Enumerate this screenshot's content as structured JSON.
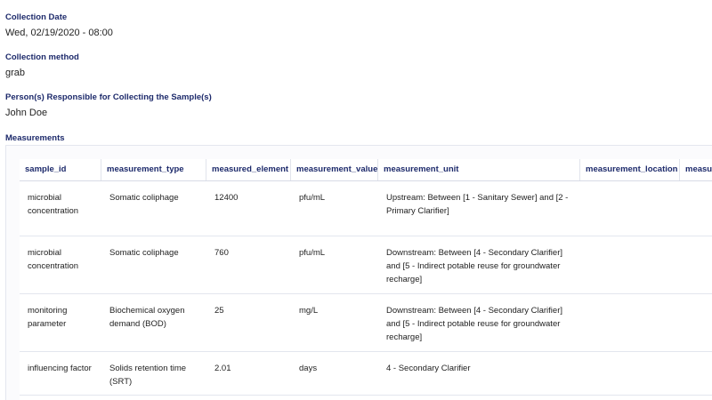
{
  "fields": {
    "collection_date": {
      "label": "Collection Date",
      "value": "Wed, 02/19/2020 - 08:00"
    },
    "collection_method": {
      "label": "Collection method",
      "value": "grab"
    },
    "responsible": {
      "label": "Person(s) Responsible for Collecting the Sample(s)",
      "value": "John Doe"
    }
  },
  "measurements": {
    "label": "Measurements",
    "columns": [
      "sample_id",
      "measurement_type",
      "measured_element",
      "measurement_value",
      "measurement_unit",
      "measurement_location",
      "measur"
    ],
    "rows": [
      [
        "microbial concentration",
        "Somatic coliphage",
        "12400",
        "pfu/mL",
        "Upstream: Between [1 - Sanitary Sewer] and [2 - Primary Clarifier]",
        "",
        ""
      ],
      [
        "microbial concentration",
        "Somatic coliphage",
        "760",
        "pfu/mL",
        "Downstream: Between [4 - Secondary Clarifier] and [5 - Indirect potable reuse for groundwater recharge]",
        "",
        ""
      ],
      [
        "monitoring parameter",
        "Biochemical oxygen demand (BOD)",
        "25",
        "mg/L",
        "Downstream: Between [4 - Secondary Clarifier] and [5 - Indirect potable reuse for groundwater recharge]",
        "",
        ""
      ],
      [
        "influencing factor",
        "Solids retention time (SRT)",
        "2.01",
        "days",
        "4 - Secondary Clarifier",
        "",
        ""
      ]
    ]
  }
}
